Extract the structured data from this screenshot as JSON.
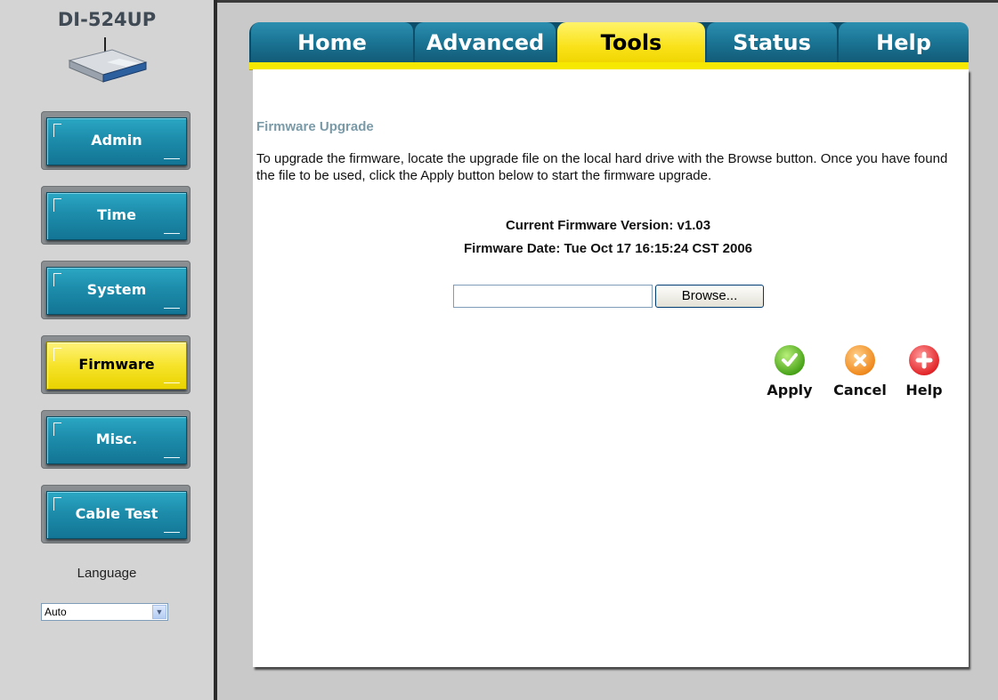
{
  "sidebar": {
    "model": "DI-524UP",
    "buttons": [
      {
        "label": "Admin",
        "active": false
      },
      {
        "label": "Time",
        "active": false
      },
      {
        "label": "System",
        "active": false
      },
      {
        "label": "Firmware",
        "active": true
      },
      {
        "label": "Misc.",
        "active": false
      },
      {
        "label": "Cable Test",
        "active": false
      }
    ],
    "language_label": "Language",
    "language_value": "Auto"
  },
  "tabs": [
    {
      "label": "Home",
      "active": false
    },
    {
      "label": "Advanced",
      "active": false
    },
    {
      "label": "Tools",
      "active": true
    },
    {
      "label": "Status",
      "active": false
    },
    {
      "label": "Help",
      "active": false
    }
  ],
  "main": {
    "section_title": "Firmware Upgrade",
    "description": "To upgrade the firmware, locate the upgrade file on the local hard drive with the Browse button. Once you have found the file to be used, click the Apply button below to start the firmware upgrade.",
    "firmware_version": "Current Firmware Version: v1.03",
    "firmware_date": "Firmware Date: Tue Oct 17 16:15:24 CST 2006",
    "file_value": "",
    "browse_label": "Browse...",
    "actions": {
      "apply": "Apply",
      "cancel": "Cancel",
      "help": "Help"
    }
  },
  "colors": {
    "tab_blue": "#1a7393",
    "tab_active_yellow": "#f9e21a",
    "section_title": "#7a9aa8",
    "apply_green": "#4aa41a",
    "cancel_orange": "#f08a1e",
    "help_red": "#e3262a"
  },
  "icons": {
    "apply": "check-circle-icon",
    "cancel": "x-circle-icon",
    "help": "plus-circle-icon",
    "model": "router-icon"
  }
}
